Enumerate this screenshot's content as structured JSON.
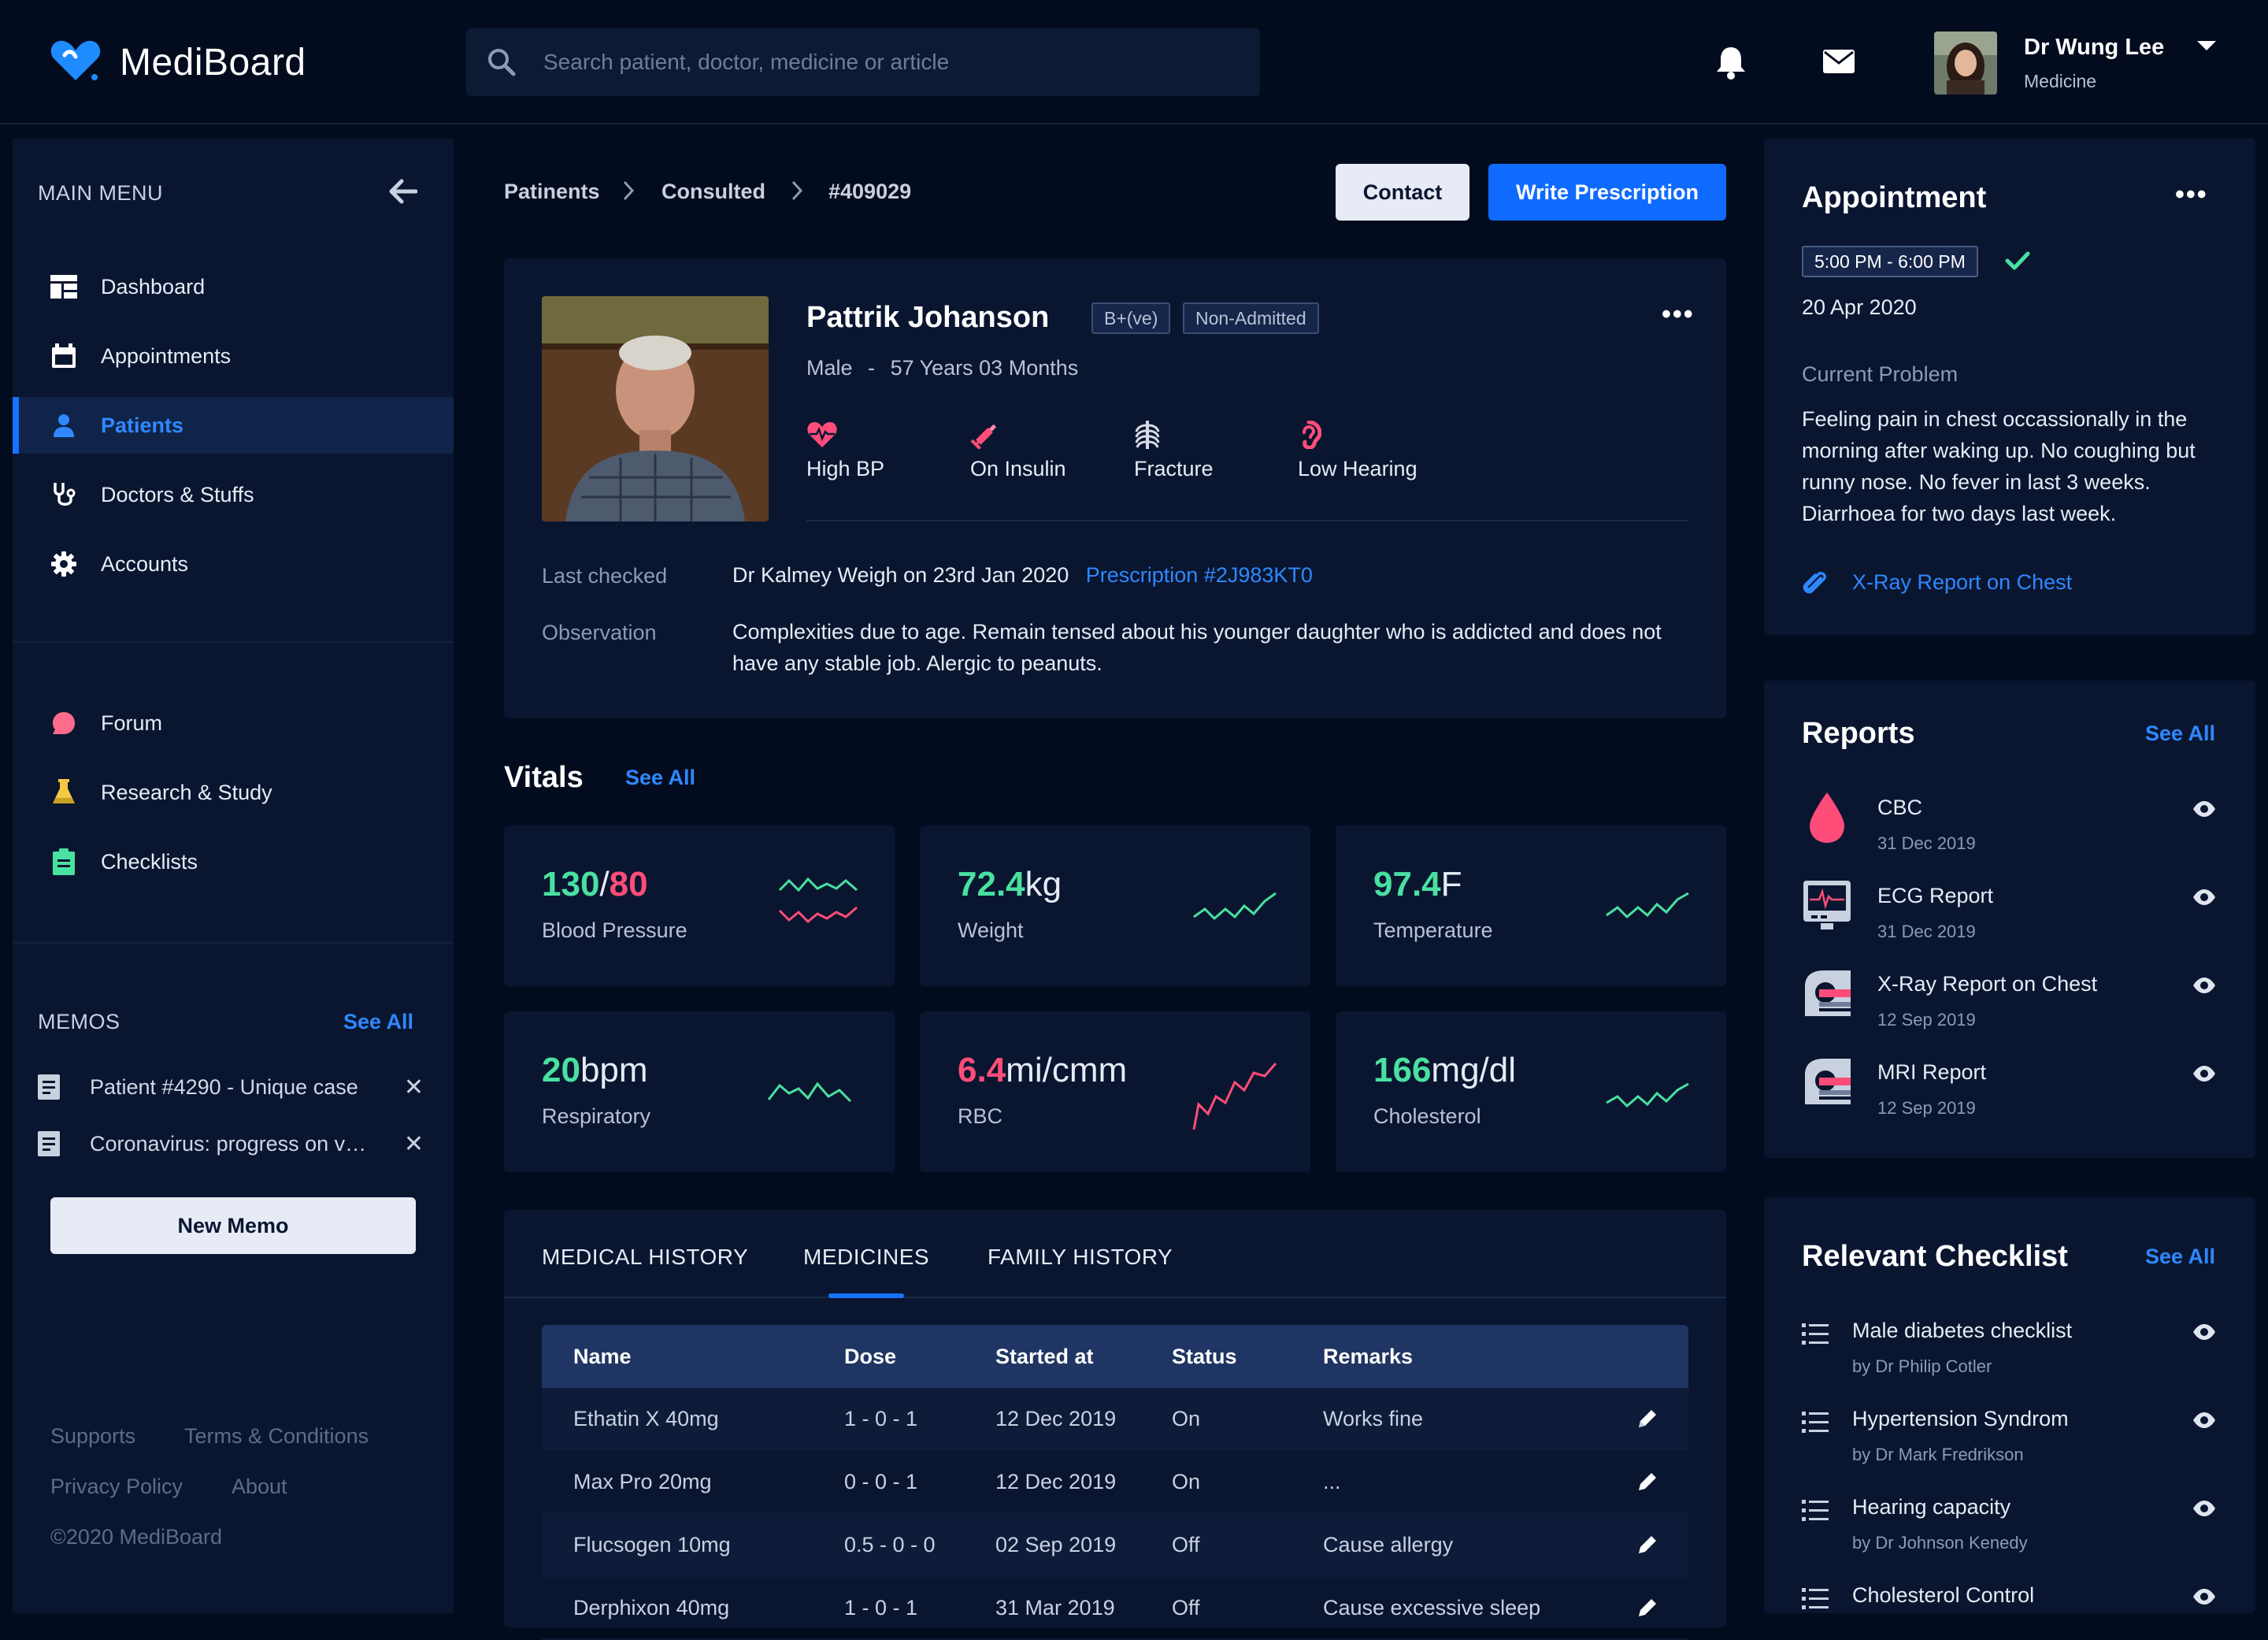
{
  "app": {
    "name": "MediBoard"
  },
  "search": {
    "placeholder": "Search patient, doctor, medicine or article"
  },
  "user": {
    "name": "Dr Wung Lee",
    "role": "Medicine"
  },
  "sidebar": {
    "heading": "MAIN MENU",
    "items": [
      {
        "label": "Dashboard",
        "icon": "dashboard-icon"
      },
      {
        "label": "Appointments",
        "icon": "calendar-icon"
      },
      {
        "label": "Patients",
        "icon": "person-icon",
        "active": true
      },
      {
        "label": "Doctors & Stuffs",
        "icon": "stethoscope-icon"
      },
      {
        "label": "Accounts",
        "icon": "gear-icon"
      }
    ],
    "secondary": [
      {
        "label": "Forum",
        "icon": "chat-bubble-icon"
      },
      {
        "label": "Research & Study",
        "icon": "flask-icon"
      },
      {
        "label": "Checklists",
        "icon": "clipboard-icon"
      }
    ],
    "memos": {
      "heading": "MEMOS",
      "see_all": "See All",
      "items": [
        {
          "text": "Patient #4290 - Unique case"
        },
        {
          "text": "Coronavirus: progress on vaccine"
        }
      ],
      "new_memo": "New Memo"
    },
    "footer": {
      "supports": "Supports",
      "terms": "Terms & Conditions",
      "privacy": "Privacy Policy",
      "about": "About",
      "copyright": "©2020 MediBoard"
    }
  },
  "breadcrumb": [
    "Patinents",
    "Consulted",
    "#409029"
  ],
  "actions": {
    "contact": "Contact",
    "write_prescription": "Write Prescription"
  },
  "patient": {
    "name": "Pattrik Johanson",
    "blood_group": "B+(ve)",
    "admission": "Non-Admitted",
    "gender": "Male",
    "sep": "-",
    "age": "57 Years 03 Months",
    "conditions": [
      {
        "label": "High BP",
        "icon": "heart-pulse-icon"
      },
      {
        "label": "On Insulin",
        "icon": "syringe-icon"
      },
      {
        "label": "Fracture",
        "icon": "ribcage-icon"
      },
      {
        "label": "Low Hearing",
        "icon": "ear-icon"
      }
    ],
    "last_checked_label": "Last checked",
    "last_checked": "Dr Kalmey Weigh on 23rd Jan 2020",
    "prescription_link": "Prescription #2J983KT0",
    "observation_label": "Observation",
    "observation": "Complexities due to age. Remain tensed about his younger daughter who is addicted and does not have any stable job. Alergic to peanuts."
  },
  "vitals": {
    "title": "Vitals",
    "see_all": "See All",
    "items": [
      {
        "value": "130",
        "value2": "80",
        "sep": "/",
        "unit": "",
        "label": "Blood Pressure"
      },
      {
        "value": "72.4",
        "unit": "kg",
        "label": "Weight"
      },
      {
        "value": "97.4",
        "unit": "F",
        "label": "Temperature"
      },
      {
        "value": "20",
        "unit": "bpm",
        "label": "Respiratory"
      },
      {
        "value": "6.4",
        "unit": "mi/cmm",
        "label": "RBC"
      },
      {
        "value": "166",
        "unit": "mg/dl",
        "label": "Cholesterol"
      }
    ],
    "colors": {
      "good": "#49e0a0",
      "bad": "#ff4d7a"
    }
  },
  "history_tabs": {
    "tabs": [
      "MEDICAL HISTORY",
      "MEDICINES",
      "FAMILY HISTORY"
    ],
    "active": "MEDICINES"
  },
  "medicines": {
    "headers": [
      "Name",
      "Dose",
      "Started at",
      "Status",
      "Remarks"
    ],
    "rows": [
      {
        "name": "Ethatin X 40mg",
        "dose": "1 - 0 - 1",
        "started": "12 Dec 2019",
        "status": "On",
        "remarks": "Works fine"
      },
      {
        "name": "Max Pro 20mg",
        "dose": "0 - 0 - 1",
        "started": "12 Dec 2019",
        "status": "On",
        "remarks": "..."
      },
      {
        "name": "Flucsogen 10mg",
        "dose": "0.5 - 0 - 0",
        "started": "02 Sep 2019",
        "status": "Off",
        "remarks": "Cause allergy"
      },
      {
        "name": "Derphixon 40mg",
        "dose": "1 - 0 - 1",
        "started": "31 Mar 2019",
        "status": "Off",
        "remarks": "Cause excessive sleep"
      }
    ]
  },
  "appointment": {
    "title": "Appointment",
    "time": "5:00 PM - 6:00 PM",
    "date": "20 Apr 2020",
    "problem_label": "Current Problem",
    "problem": "Feeling pain in chest occassionally in the morning after waking up. No coughing but runny nose. No fever in last 3 weeks. Diarrhoea for two days last week.",
    "attachment": "X-Ray Report on Chest"
  },
  "reports": {
    "title": "Reports",
    "see_all": "See All",
    "items": [
      {
        "name": "CBC",
        "date": "31 Dec 2019",
        "icon": "blood-drop-icon"
      },
      {
        "name": "ECG Report",
        "date": "31 Dec 2019",
        "icon": "ecg-monitor-icon"
      },
      {
        "name": "X-Ray Report on Chest",
        "date": "12 Sep 2019",
        "icon": "scanner-icon"
      },
      {
        "name": "MRI Report",
        "date": "12 Sep 2019",
        "icon": "scanner-icon"
      }
    ]
  },
  "checklist": {
    "title": "Relevant Checklist",
    "see_all": "See All",
    "items": [
      {
        "name": "Male diabetes checklist",
        "by": "by Dr Philip Cotler"
      },
      {
        "name": "Hypertension Syndrom",
        "by": "by Dr Mark Fredrikson"
      },
      {
        "name": "Hearing capacity",
        "by": "by Dr Johnson Kenedy"
      },
      {
        "name": "Cholesterol Control",
        "by": ""
      }
    ]
  }
}
